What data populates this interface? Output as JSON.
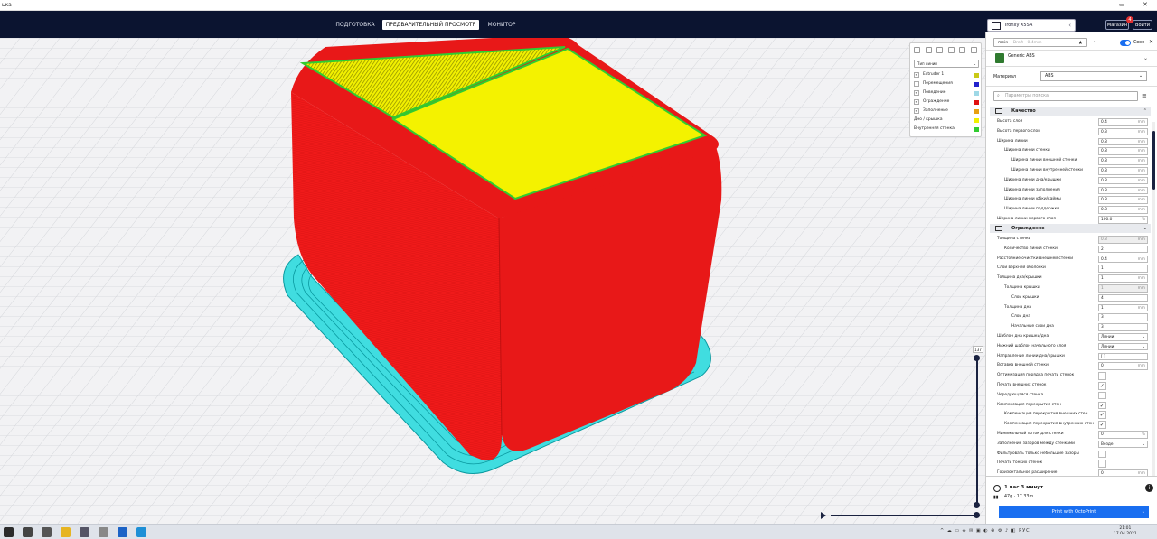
{
  "window": {
    "title": "ька",
    "minimize": "—",
    "maximize": "▭",
    "close": "✕"
  },
  "header": {
    "tabs": [
      {
        "label": "ПОДГОТОВКА"
      },
      {
        "label": "ПРЕДВАРИТЕЛЬНЫЙ ПРОСМОТР"
      },
      {
        "label": "МОНИТОР"
      }
    ],
    "printer": "Tronxy X5SA",
    "marketplace_label": "Магазин",
    "signin_label": "Войти",
    "notifications": "4"
  },
  "legend": {
    "view_type": "Тип линии",
    "items": [
      {
        "label": "Extruder 1",
        "checked": true,
        "color": "#c9c916",
        "swatch_class": "extruder"
      },
      {
        "label": "Перемещения",
        "checked": false,
        "color": "#2222cc"
      },
      {
        "label": "Поведение",
        "checked": true,
        "color": "#9ed8e6"
      },
      {
        "label": "Ограждение",
        "checked": true,
        "color": "#e01010"
      },
      {
        "label": "Заполнение",
        "checked": true,
        "color": "#e8a010"
      },
      {
        "label": "Дно / крышка",
        "checked": false,
        "color": "#f0f000"
      },
      {
        "label": "Внутренняя стенка",
        "checked": false,
        "color": "#30cc30"
      }
    ],
    "check_glyph": "✓"
  },
  "layer_slider": {
    "value": "137",
    "play_icon": "play-icon"
  },
  "panel": {
    "profile_name": "mein",
    "profile_hint": "Draft - 0.4mm",
    "custom_label": "Своя",
    "material_name": "Generic ABS",
    "material_field_label": "Материал",
    "material_value": "ABS",
    "search_placeholder": "Параметры поиска",
    "sections": [
      {
        "title": "Качество"
      },
      {
        "title": "Ограждение"
      }
    ],
    "quality_rows": [
      {
        "label": "Высота слоя",
        "value": "0.4",
        "unit": "mm",
        "indent": 0
      },
      {
        "label": "Высота первого слоя",
        "value": "0.3",
        "unit": "mm",
        "indent": 0
      },
      {
        "label": "Ширина линии",
        "value": "0.8",
        "unit": "mm",
        "indent": 0
      },
      {
        "label": "Ширина линии стенки",
        "value": "0.8",
        "unit": "mm",
        "indent": 1
      },
      {
        "label": "Ширина линии внешней стенки",
        "value": "0.8",
        "unit": "mm",
        "indent": 2
      },
      {
        "label": "Ширина линии внутренней стенки",
        "value": "0.8",
        "unit": "mm",
        "indent": 2
      },
      {
        "label": "Ширина линии дна/крышки",
        "value": "0.8",
        "unit": "mm",
        "indent": 1
      },
      {
        "label": "Ширина линии заполнения",
        "value": "0.8",
        "unit": "mm",
        "indent": 1
      },
      {
        "label": "Ширина линии юбки/каймы",
        "value": "0.8",
        "unit": "mm",
        "indent": 1
      },
      {
        "label": "Ширина линии поддержки",
        "value": "0.8",
        "unit": "mm",
        "indent": 1
      },
      {
        "label": "Ширина линии первого слоя",
        "value": "100.0",
        "unit": "%",
        "indent": 0
      }
    ],
    "shell_rows": [
      {
        "label": "Толщина стенки",
        "value": "0.8",
        "unit": "mm",
        "indent": 0,
        "disabled": true
      },
      {
        "label": "Количество линий стенки",
        "value": "2",
        "unit": "",
        "indent": 1
      },
      {
        "label": "Расстояние очистки внешней стенки",
        "value": "0.4",
        "unit": "mm",
        "indent": 0
      },
      {
        "label": "Слои верхней оболочки",
        "value": "1",
        "unit": "",
        "indent": 0
      },
      {
        "label": "Толщина дна/крышки",
        "value": "1",
        "unit": "mm",
        "indent": 0
      },
      {
        "label": "Толщина крышки",
        "value": "1",
        "unit": "mm",
        "indent": 1,
        "disabled": true
      },
      {
        "label": "Слои крышки",
        "value": "4",
        "unit": "",
        "indent": 2
      },
      {
        "label": "Толщина дна",
        "value": "1",
        "unit": "mm",
        "indent": 1
      },
      {
        "label": "Слои дна",
        "value": "3",
        "unit": "",
        "indent": 2
      },
      {
        "label": "Начальные слои дна",
        "value": "3",
        "unit": "",
        "indent": 2
      },
      {
        "label": "Шаблон дна крышки/дна",
        "select": "Линии",
        "indent": 0
      },
      {
        "label": "Нижний шаблон начального слоя",
        "select": "Линии",
        "indent": 0
      },
      {
        "label": "Направление линии дна/крышки",
        "value": "[ ]",
        "unit": "",
        "indent": 0
      },
      {
        "label": "Вставка внешней стенки",
        "value": "0",
        "unit": "mm",
        "indent": 0
      },
      {
        "label": "Оптимизация порядка печати стенок",
        "checkbox": false,
        "indent": 0
      },
      {
        "label": "Печать внешних стенок",
        "checkbox": true,
        "indent": 0
      },
      {
        "label": "Чередующаяся стенка",
        "checkbox": false,
        "indent": 0
      },
      {
        "label": "Компенсация перекрытия стен",
        "checkbox": true,
        "indent": 0
      },
      {
        "label": "Компенсация перекрытия внешних стен",
        "checkbox": true,
        "indent": 1
      },
      {
        "label": "Компенсация перекрытия внутренних стен",
        "checkbox": true,
        "indent": 1
      },
      {
        "label": "Минимальный поток для стенки",
        "value": "0",
        "unit": "%",
        "indent": 0
      },
      {
        "label": "Заполнение зазоров между стенками",
        "select": "Везде",
        "indent": 0
      },
      {
        "label": "Фильтровать только небольшие зазоры",
        "checkbox": false,
        "indent": 0
      },
      {
        "label": "Печать тонких стенок",
        "checkbox": false,
        "indent": 0
      },
      {
        "label": "Горизонтальное расширение",
        "value": "0",
        "unit": "mm",
        "indent": 0
      }
    ],
    "print_time": "1 час 3 минут",
    "material_usage": "47g · 17.33m",
    "print_button": "Print with OctoPrint"
  },
  "taskbar": {
    "apps": [
      {
        "name": "windows-start-icon",
        "color": "#2b2b2b"
      },
      {
        "name": "search-icon",
        "color": "#444"
      },
      {
        "name": "task-view-icon",
        "color": "#555"
      },
      {
        "name": "file-explorer-icon",
        "color": "#e6b422"
      },
      {
        "name": "calculator-icon",
        "color": "#556"
      },
      {
        "name": "app-icon",
        "color": "#888"
      },
      {
        "name": "cura-icon",
        "color": "#1c63c6"
      },
      {
        "name": "edge-icon",
        "color": "#1e8fd6"
      }
    ],
    "tray": "^ ☁ ▭ ◈ ✉ ▣ ◐ ⊕ ⚙ ♪ ◧ РУС",
    "time": "21:01",
    "date": "17.04.2021"
  }
}
